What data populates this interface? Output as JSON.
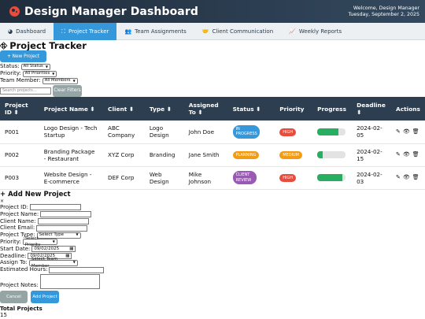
{
  "header": {
    "title": "Design Manager Dashboard",
    "welcome_line1": "Welcome, Design Manager",
    "welcome_line2": "Tuesday, September 2, 2025"
  },
  "nav": {
    "tabs": [
      {
        "label": "Dashboard",
        "icon": "gauge-icon",
        "active": false
      },
      {
        "label": "Project Tracker",
        "icon": "network-icon",
        "active": true
      },
      {
        "label": "Team Assignments",
        "icon": "users-icon",
        "active": false
      },
      {
        "label": "Client Communication",
        "icon": "handshake-icon",
        "active": false
      },
      {
        "label": "Weekly Reports",
        "icon": "chart-icon",
        "active": false
      }
    ]
  },
  "tracker": {
    "title": "Project Tracker",
    "new_project_label": "+ New Project"
  },
  "filters": {
    "status_label": "Status:",
    "status_value": "All Status",
    "priority_label": "Priority:",
    "priority_value": "All Priorities",
    "member_label": "Team Member:",
    "member_value": "All Members",
    "search_placeholder": "Search projects...",
    "clear_label": "Clear Filters"
  },
  "table": {
    "headers": [
      "Project ID ⬍",
      "Project Name ⬍",
      "Client ⬍",
      "Type ⬍",
      "Assigned To ⬍",
      "Status ⬍",
      "Priority",
      "Progress",
      "Deadline ⬍",
      "Actions"
    ],
    "rows": [
      {
        "id": "P001",
        "name": "Logo Design - Tech Startup",
        "client": "ABC Company",
        "type": "Logo Design",
        "assigned": "John Doe",
        "status": "IN PROGRESS",
        "status_color": "#3498db",
        "priority": "HIGH",
        "priority_color": "#e74c3c",
        "progress": 75,
        "deadline": "2024-02-05"
      },
      {
        "id": "P002",
        "name": "Branding Package - Restaurant",
        "client": "XYZ Corp",
        "type": "Branding",
        "assigned": "Jane Smith",
        "status": "PLANNING",
        "status_color": "#f39c12",
        "priority": "MEDIUM",
        "priority_color": "#f39c12",
        "progress": 20,
        "deadline": "2024-02-15"
      },
      {
        "id": "P003",
        "name": "Website Design - E-commerce",
        "client": "DEF Corp",
        "type": "Web Design",
        "assigned": "Mike Johnson",
        "status": "CLIENT REVIEW",
        "status_color": "#9b59b6",
        "priority": "HIGH",
        "priority_color": "#e74c3c",
        "progress": 90,
        "deadline": "2024-02-03"
      }
    ]
  },
  "add_form": {
    "title": "+ Add New Project",
    "close": "×",
    "project_id_label": "Project ID:",
    "project_name_label": "Project Name:",
    "client_name_label": "Client Name:",
    "client_email_label": "Client Email:",
    "project_type_label": "Project Type:",
    "project_type_value": "Select Type",
    "priority_label": "Priority:",
    "priority_value": "Select Priority",
    "start_date_label": "Start Date:",
    "start_date_value": "09/02/2025",
    "deadline_label": "Deadline:",
    "deadline_value": "09/02/2025",
    "assign_label": "Assign To:",
    "assign_value": "Select Team Member",
    "hours_label": "Estimated Hours:",
    "notes_label": "Project Notes:",
    "cancel_label": "Cancel",
    "add_label": "Add Project"
  },
  "stats": {
    "total_label": "Total Projects",
    "total_value": "15"
  }
}
